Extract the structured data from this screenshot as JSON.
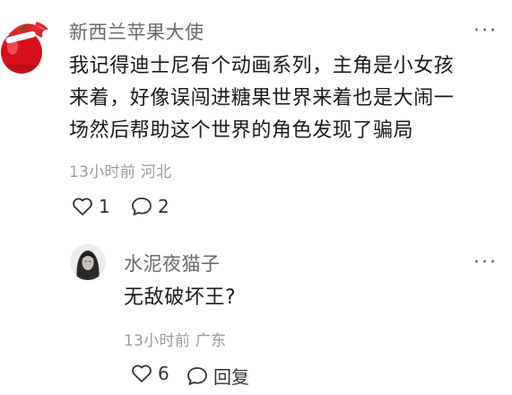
{
  "comment": {
    "author": "新西兰苹果大使",
    "text_lines": [
      "我记得迪士尼有个动画系列，主角是小女孩",
      "来着，好像误闯进糖果世界来着也是大闹一",
      "场然后帮助这个世界的角色发现了骗局"
    ],
    "time": "13小时前",
    "location": "河北",
    "like_count": "1",
    "reply_count": "2",
    "more_label": "···"
  },
  "reply": {
    "author": "水泥夜猫子",
    "text": "无敌破坏王?",
    "time": "13小时前",
    "location": "广东",
    "like_count": "6",
    "reply_label": "回复",
    "more_label": "···"
  },
  "colors": {
    "apple_red": "#d4101a",
    "hat_red": "#e0262a",
    "muted": "#9a9a9a"
  },
  "icons": {
    "like": "heart-outline-icon",
    "comment": "speech-bubble-icon",
    "more": "more-dots-icon"
  }
}
